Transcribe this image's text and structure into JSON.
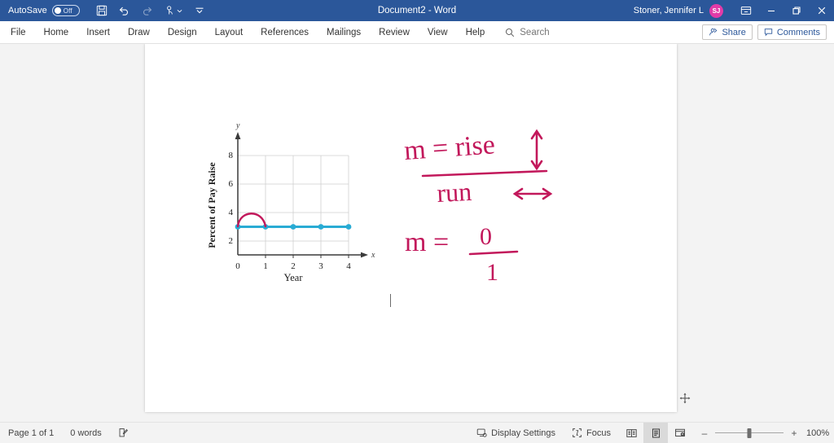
{
  "titlebar": {
    "autosave_label": "AutoSave",
    "autosave_state": "Off",
    "document_title": "Document2  -  Word",
    "user_name": "Stoner, Jennifer L",
    "avatar_initials": "SJ",
    "quick_access": [
      {
        "name": "save-icon",
        "label": "Save"
      },
      {
        "name": "undo-icon",
        "label": "Undo"
      },
      {
        "name": "redo-icon",
        "label": "Redo"
      },
      {
        "name": "touch-mode-icon",
        "label": "Touch/Mouse Mode"
      },
      {
        "name": "customize-quick-access-icon",
        "label": "Customize Quick Access Toolbar"
      }
    ],
    "window_controls": [
      {
        "name": "ribbon-display-options-icon",
        "label": "Ribbon Display Options"
      },
      {
        "name": "minimize-icon",
        "label": "Minimize"
      },
      {
        "name": "restore-icon",
        "label": "Restore Down"
      },
      {
        "name": "close-icon",
        "label": "Close"
      }
    ]
  },
  "ribbon": {
    "tabs": [
      {
        "label": "File"
      },
      {
        "label": "Home"
      },
      {
        "label": "Insert"
      },
      {
        "label": "Draw"
      },
      {
        "label": "Design"
      },
      {
        "label": "Layout"
      },
      {
        "label": "References"
      },
      {
        "label": "Mailings"
      },
      {
        "label": "Review"
      },
      {
        "label": "View"
      },
      {
        "label": "Help"
      }
    ],
    "search_placeholder": "Search",
    "share_label": "Share",
    "comments_label": "Comments"
  },
  "document": {
    "figure": {
      "handwriting": {
        "line1": "m = rise",
        "line2": "run",
        "line3": "m =",
        "numerator": "0",
        "denominator": "1",
        "vertical_arrow": "rise-arrow-icon",
        "horizontal_arrow": "run-arrow-icon"
      }
    }
  },
  "statusbar": {
    "page_label": "Page 1 of 1",
    "word_count": "0 words",
    "proofing_icon": "proofing-icon",
    "display_settings_label": "Display Settings",
    "focus_label": "Focus",
    "views": [
      {
        "name": "read-mode-icon",
        "label": "Read Mode",
        "active": false
      },
      {
        "name": "print-layout-icon",
        "label": "Print Layout",
        "active": true
      },
      {
        "name": "web-layout-icon",
        "label": "Web Layout",
        "active": false
      }
    ],
    "zoom_out": "–",
    "zoom_in": "+",
    "zoom_level": "100%"
  },
  "chart_data": {
    "type": "line",
    "title": "",
    "xlabel": "Year",
    "ylabel": "Percent of Pay Raise",
    "x": [
      0,
      1,
      2,
      3,
      4
    ],
    "values": [
      3,
      3,
      3,
      3,
      3
    ],
    "series": [
      {
        "name": "Percent of Pay Raise",
        "values": [
          3,
          3,
          3,
          3,
          3
        ],
        "color": "#29ABD4"
      }
    ],
    "xticks": [
      "0",
      "1",
      "2",
      "3",
      "4"
    ],
    "yticks": [
      "2",
      "4",
      "6",
      "8"
    ],
    "xlim": [
      0,
      4.4
    ],
    "ylim": [
      0,
      9
    ],
    "grid": true,
    "legend": "none",
    "axis_labels": {
      "x_axis_symbol": "x",
      "y_axis_symbol": "y"
    },
    "annotations": [
      {
        "type": "arc",
        "label": "run-arc",
        "from_x": 0,
        "to_x": 1,
        "at_y": 3,
        "peak_y": 4.1,
        "color": "#C2185B"
      }
    ],
    "marker_color": "#29ABD4",
    "line_color": "#29ABD4",
    "ink_color": "#C2185B"
  }
}
